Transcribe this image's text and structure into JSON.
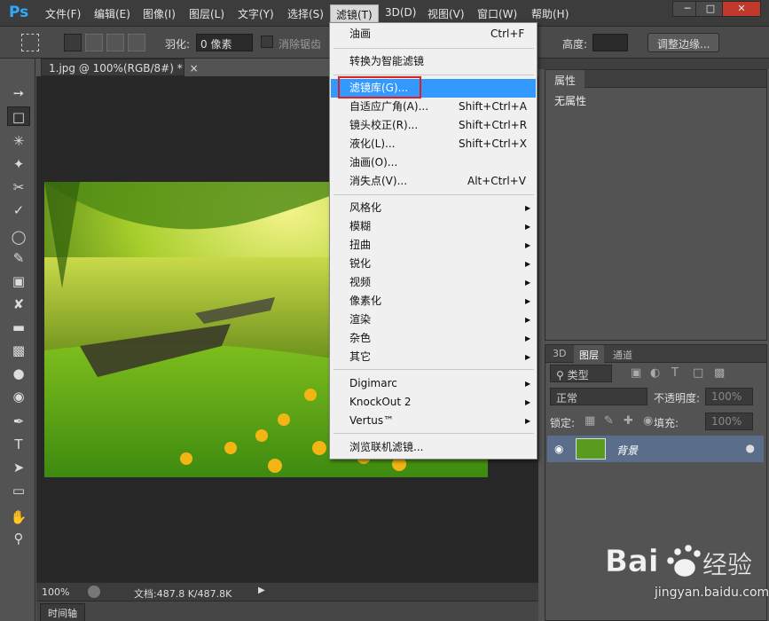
{
  "app": {
    "logo": "Ps"
  },
  "menubar": {
    "items": [
      "文件(F)",
      "编辑(E)",
      "图像(I)",
      "图层(L)",
      "文字(Y)",
      "选择(S)",
      "滤镜(T)",
      "3D(D)",
      "视图(V)",
      "窗口(W)",
      "帮助(H)"
    ],
    "active": "滤镜(T)"
  },
  "options": {
    "feather_label": "羽化:",
    "feather_value": "0 像素",
    "antialias_label": "消除锯齿",
    "height_label": "高度:",
    "refine_edge_button": "调整边缘..."
  },
  "document": {
    "tab_title": "1.jpg @ 100%(RGB/8#) *",
    "zoom": "100%",
    "doc_size": "文档:487.8 K/487.8K"
  },
  "timeline": {
    "label": "时间轴"
  },
  "properties": {
    "tab": "属性",
    "text": "无属性"
  },
  "layers": {
    "tabs": [
      "3D",
      "图层",
      "通道"
    ],
    "active_tab": "图层",
    "filter_kind": "类型",
    "blend_mode": "正常",
    "opacity_label": "不透明度:",
    "opacity_value": "100%",
    "lock_label": "锁定:",
    "fill_label": "填充:",
    "fill_value": "100%",
    "layer_name": "背景"
  },
  "filter_menu": {
    "items": [
      {
        "label": "油画",
        "shortcut": "Ctrl+F"
      },
      {
        "label": "转换为智能滤镜"
      },
      {
        "label": "滤镜库(G)...",
        "highlighted": true
      },
      {
        "label": "自适应广角(A)...",
        "shortcut": "Shift+Ctrl+A"
      },
      {
        "label": "镜头校正(R)...",
        "shortcut": "Shift+Ctrl+R"
      },
      {
        "label": "液化(L)...",
        "shortcut": "Shift+Ctrl+X"
      },
      {
        "label": "油画(O)..."
      },
      {
        "label": "消失点(V)...",
        "shortcut": "Alt+Ctrl+V"
      },
      {
        "label": "风格化",
        "submenu": true
      },
      {
        "label": "模糊",
        "submenu": true
      },
      {
        "label": "扭曲",
        "submenu": true
      },
      {
        "label": "锐化",
        "submenu": true
      },
      {
        "label": "视频",
        "submenu": true
      },
      {
        "label": "像素化",
        "submenu": true
      },
      {
        "label": "渲染",
        "submenu": true
      },
      {
        "label": "杂色",
        "submenu": true
      },
      {
        "label": "其它",
        "submenu": true
      },
      {
        "label": "Digimarc",
        "submenu": true
      },
      {
        "label": "KnockOut 2",
        "submenu": true
      },
      {
        "label": "Vertus™",
        "submenu": true
      },
      {
        "label": "浏览联机滤镜..."
      }
    ]
  },
  "watermark": {
    "brand": "Baidu经验",
    "url": "jingyan.baidu.com"
  },
  "colors": {
    "highlight": "#3399ff",
    "annotation": "#e02020",
    "ps_blue": "#31a8ff"
  }
}
